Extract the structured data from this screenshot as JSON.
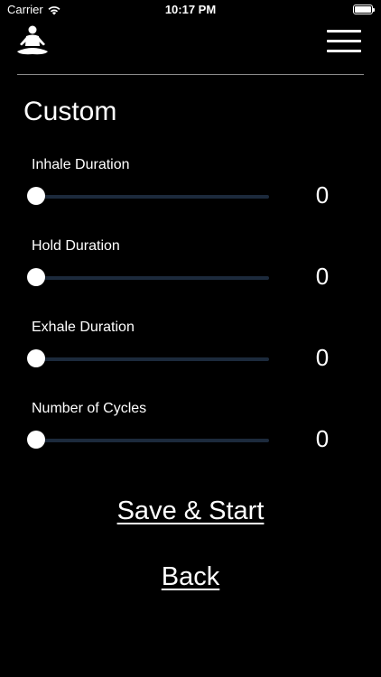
{
  "status_bar": {
    "carrier": "Carrier",
    "time": "10:17 PM",
    "wifi_icon": "wifi-icon",
    "battery_icon": "battery-full-icon"
  },
  "header": {
    "logo_icon": "meditation-icon",
    "menu_icon": "hamburger-menu-icon"
  },
  "page": {
    "title": "Custom"
  },
  "settings": [
    {
      "label": "Inhale Duration",
      "value": "0",
      "level": 0
    },
    {
      "label": "Hold Duration",
      "value": "0",
      "level": 0
    },
    {
      "label": "Exhale Duration",
      "value": "0",
      "level": 0
    },
    {
      "label": "Number of Cycles",
      "value": "0",
      "level": 0
    }
  ],
  "actions": {
    "save_start_label": "Save & Start",
    "back_label": "Back"
  },
  "colors": {
    "background": "#000000",
    "text": "#ffffff",
    "slider_track": "#1c2a3c",
    "divider": "#8a8a8a"
  }
}
